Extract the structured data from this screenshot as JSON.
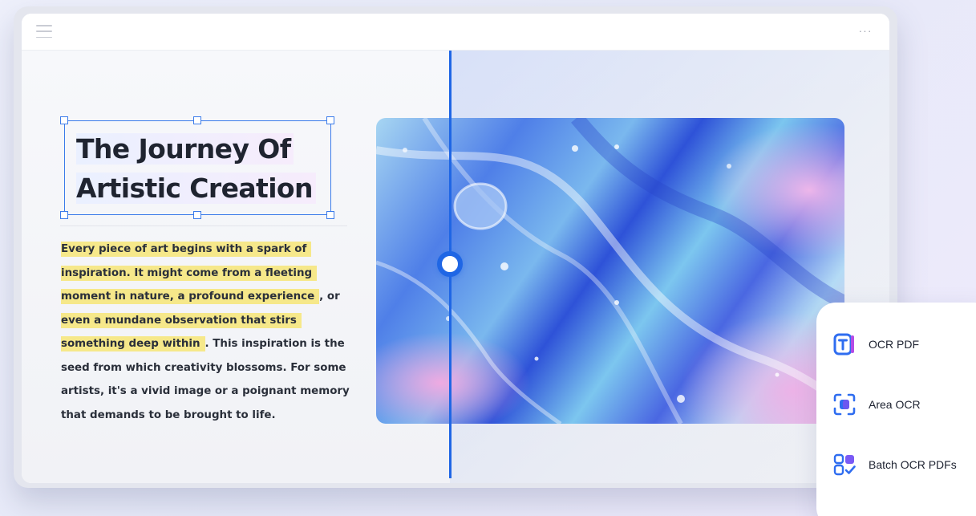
{
  "toolbar": {
    "menu_icon": "hamburger-menu-icon",
    "more_label": "···",
    "more_icon": "more-options-icon"
  },
  "document": {
    "title_line1": "The Journey Of",
    "title_line2": "Artistic Creation",
    "paragraph": {
      "h1": "Every piece of art begins with a spark of",
      "h2": "inspiration. It might come from a fleeting",
      "h3": "moment in nature, a profound experience",
      "t3": ", or",
      "h4": "even a mundane observation that stirs",
      "h5": "something deep within",
      "t5": ". This inspiration is the",
      "l6": "seed from which creativity blossoms. For some",
      "l7": "artists, it's a vivid image or a poignant memory",
      "l8": "that demands to be brought to life."
    },
    "image": "fluid-marble-artwork"
  },
  "ocr_menu": {
    "items": [
      {
        "label": "OCR PDF",
        "icon": "ocr-pdf-icon"
      },
      {
        "label": "Area OCR",
        "icon": "area-ocr-icon"
      },
      {
        "label": "Batch OCR PDFs",
        "icon": "batch-ocr-icon"
      }
    ]
  },
  "colors": {
    "accent": "#1f66e5",
    "highlight": "#f6e88a",
    "selection": "#3b7bea"
  }
}
